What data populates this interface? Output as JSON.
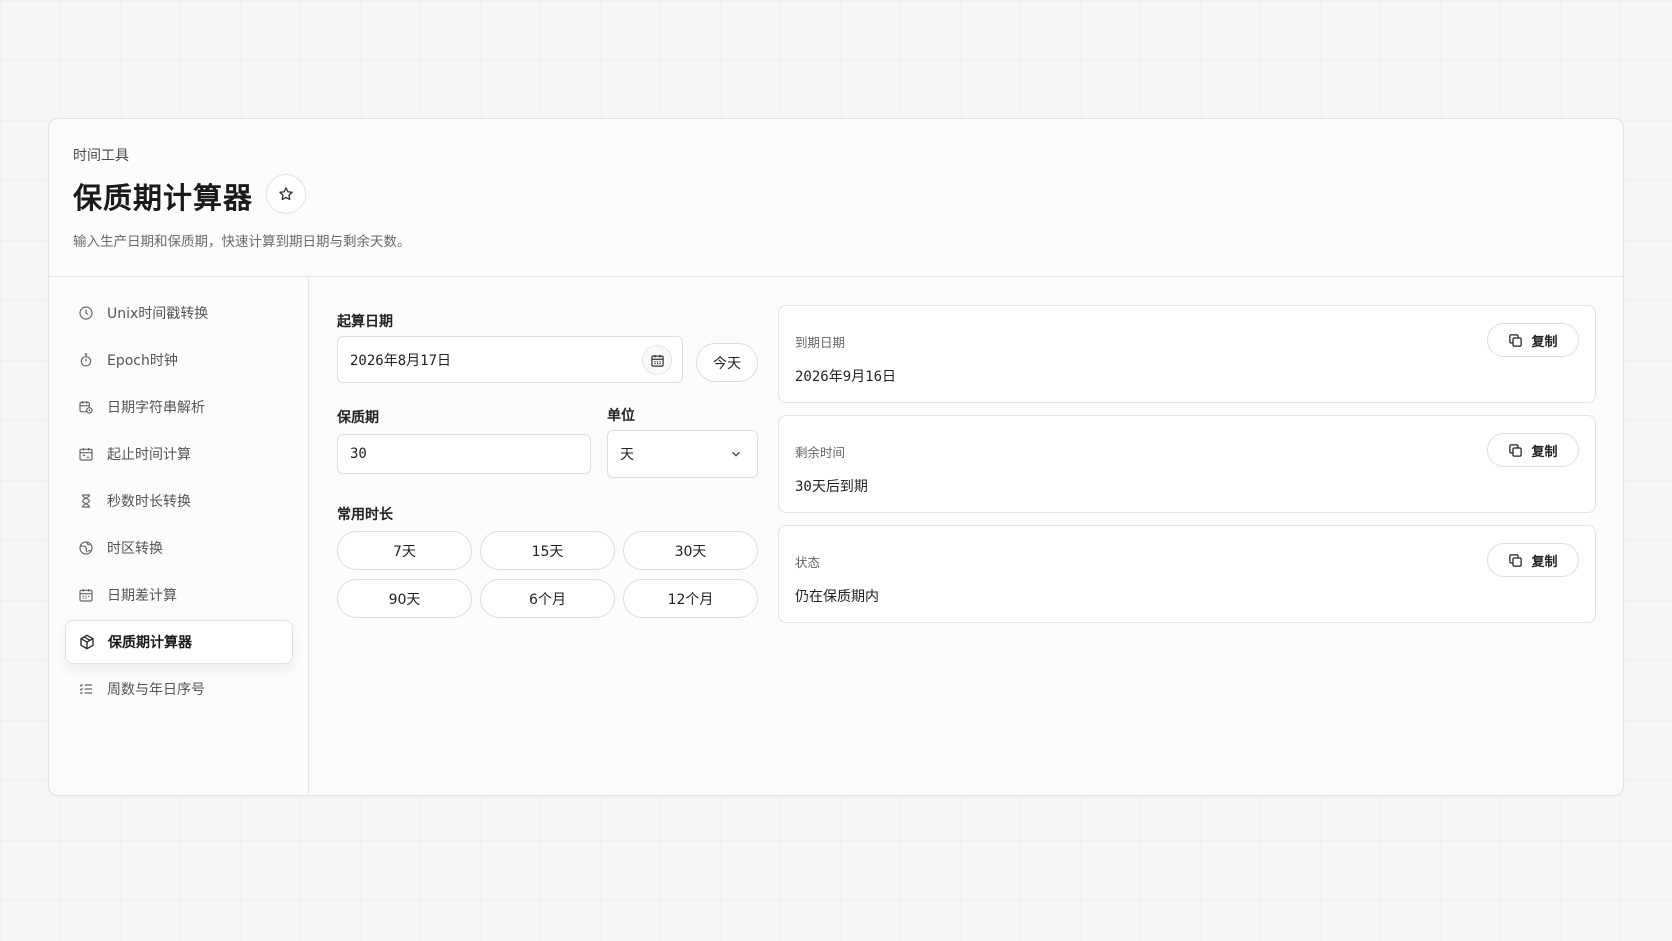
{
  "header": {
    "breadcrumb": "时间工具",
    "title": "保质期计算器",
    "description": "输入生产日期和保质期，快速计算到期日期与剩余天数。"
  },
  "sidebar": {
    "items": [
      {
        "label": "Unix时间戳转换",
        "icon": "clock-icon"
      },
      {
        "label": "Epoch时钟",
        "icon": "stopwatch-icon"
      },
      {
        "label": "日期字符串解析",
        "icon": "calendar-clock-icon"
      },
      {
        "label": "起止时间计算",
        "icon": "calendar-range-icon"
      },
      {
        "label": "秒数时长转换",
        "icon": "hourglass-icon"
      },
      {
        "label": "时区转换",
        "icon": "globe-icon"
      },
      {
        "label": "日期差计算",
        "icon": "calendar-icon"
      },
      {
        "label": "保质期计算器",
        "icon": "package-icon",
        "active": true
      },
      {
        "label": "周数与年日序号",
        "icon": "list-check-icon"
      }
    ]
  },
  "form": {
    "start_label": "起算日期",
    "start_value": "2026年8月17日",
    "today_label": "今天",
    "shelf_label": "保质期",
    "shelf_value": "30",
    "unit_label": "单位",
    "unit_value": "天",
    "presets_label": "常用时长",
    "presets": [
      "7天",
      "15天",
      "30天",
      "90天",
      "6个月",
      "12个月"
    ]
  },
  "results": {
    "copy_label": "复制",
    "items": [
      {
        "label": "到期日期",
        "value": "2026年9月16日"
      },
      {
        "label": "剩余时间",
        "value": "30天后到期"
      },
      {
        "label": "状态",
        "value": "仍在保质期内"
      }
    ]
  }
}
